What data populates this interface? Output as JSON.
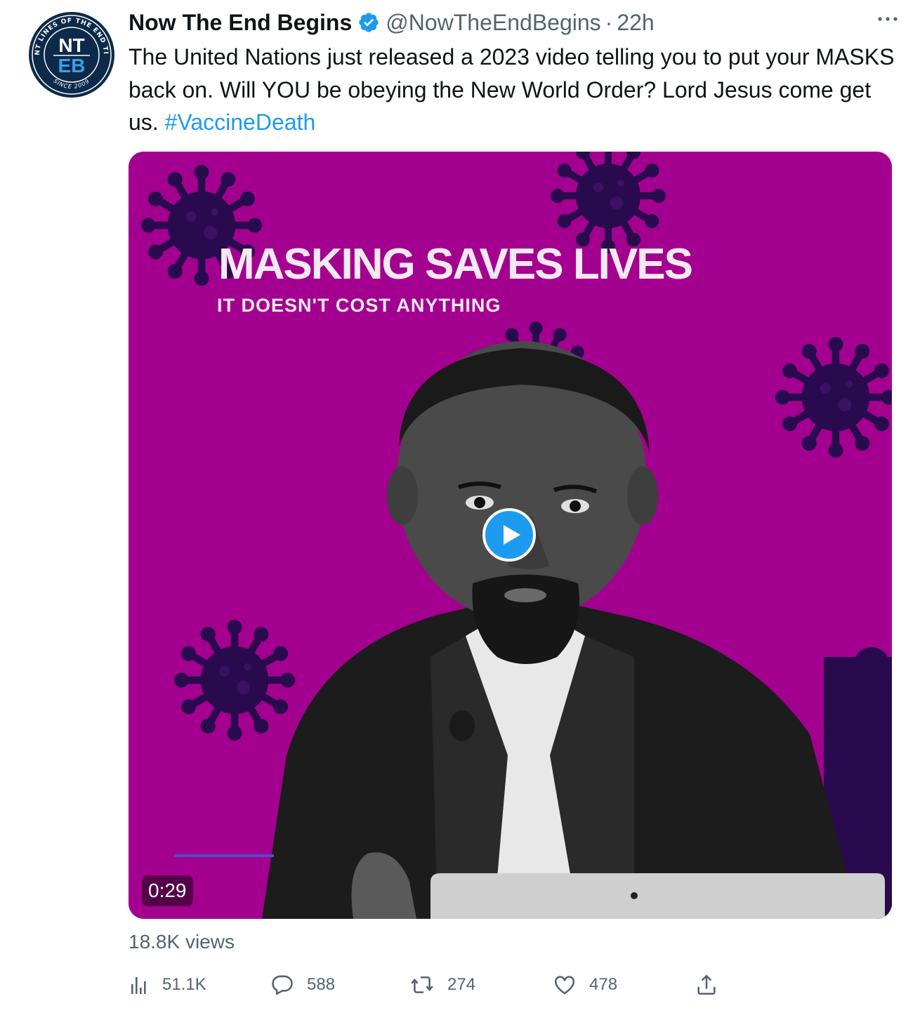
{
  "tweet": {
    "display_name": "Now The End Begins",
    "handle": "@NowTheEndBegins",
    "separator": "·",
    "time": "22h",
    "text_main": "The United Nations just released a 2023 video telling you to put your MASKS back on. Will YOU be obeying the New World Order? Lord Jesus come get us.",
    "hashtag": "#VaccineDeath",
    "views": "18.8K views"
  },
  "avatar": {
    "logo_top": "NT",
    "logo_bottom": "EB",
    "ring_text": "FRONT LINES OF THE END TIMES",
    "since_text": "SINCE 2009"
  },
  "media": {
    "headline": "MASKING SAVES LIVES",
    "subhead": "IT DOESN'T COST ANYTHING",
    "duration": "0:29",
    "background_color": "#a3008f"
  },
  "actions": {
    "analytics": "51.1K",
    "replies": "588",
    "retweets": "274",
    "likes": "478"
  },
  "colors": {
    "accent": "#1d9bf0",
    "secondary_text": "#536471"
  }
}
